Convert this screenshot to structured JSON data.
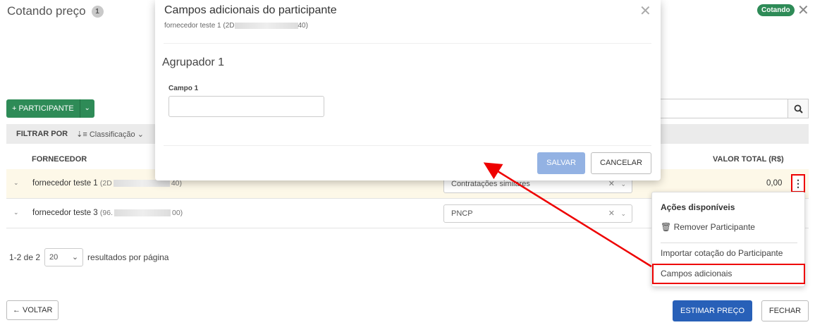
{
  "page": {
    "title": "Cotando preço",
    "count": "1",
    "status": "Cotando",
    "close_glyph": "✕"
  },
  "toolbar": {
    "add_participant": "+ PARTICIPANTE",
    "add_caret": "⌄",
    "search_icon": "search-icon"
  },
  "filter": {
    "label": "FILTRAR POR",
    "sort_label": "Classificação"
  },
  "table": {
    "headers": {
      "supplier": "FORNECEDOR",
      "total": "VALOR TOTAL (R$)"
    },
    "rows": [
      {
        "name": "fornecedor teste 1",
        "doc_prefix": "(2D",
        "doc_suffix": "40)",
        "source": "Contratações similares",
        "total": "0,00"
      },
      {
        "name": "fornecedor teste 3",
        "doc_prefix": "(96.",
        "doc_suffix": "00)",
        "source": "PNCP",
        "total": ""
      }
    ]
  },
  "pager": {
    "range": "1-2 de 2",
    "page_size": "20",
    "per_page_label": "resultados por página"
  },
  "footer": {
    "back": "← VOLTAR",
    "estimate": "ESTIMAR PREÇO",
    "close": "FECHAR"
  },
  "menu": {
    "header": "Ações disponíveis",
    "remove": "Remover Participante",
    "import": "Importar cotação do Participante",
    "extra_fields": "Campos adicionais"
  },
  "modal": {
    "title": "Campos adicionais do participante",
    "subtitle_prefix": "fornecedor teste 1 (2D",
    "subtitle_suffix": "40)",
    "group": "Agrupador 1",
    "field_label": "Campo 1",
    "field_value": "",
    "save": "SALVAR",
    "cancel": "CANCELAR"
  },
  "colors": {
    "accent_green": "#2e8b57",
    "primary_blue": "#2860b8",
    "disabled_blue": "#93b2e3",
    "highlight_red": "#e00000"
  }
}
